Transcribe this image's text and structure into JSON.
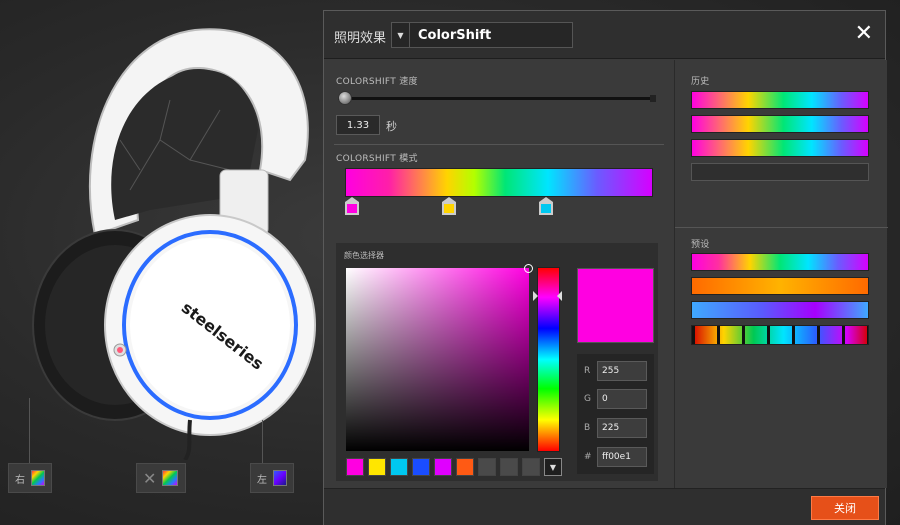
{
  "dialog": {
    "title": "照明效果",
    "effect_value": "ColorShift",
    "close_button": "关闭"
  },
  "speed": {
    "label": "COLORSHIFT 速度",
    "value": "1.33",
    "unit": "秒",
    "slider_fraction": 0.0
  },
  "pattern": {
    "label": "COLORSHIFT 模式",
    "stops": [
      {
        "color": "#ff00e1",
        "position": 0.0
      },
      {
        "color": "#ffd400",
        "position": 0.33
      },
      {
        "color": "#00c8f0",
        "position": 0.66
      }
    ]
  },
  "picker": {
    "label": "颜色选择器",
    "current_color": "#ff00e1",
    "r": "255",
    "g": "0",
    "b": "225",
    "hex": "ff00e1",
    "r_label": "R",
    "g_label": "G",
    "b_label": "B",
    "hex_label": "#",
    "palette": [
      "#ff00e1",
      "#ffe600",
      "#00c8f0",
      "#1a4dff",
      "#e000ff",
      "#ff5a14",
      "#4a4a4a",
      "#4a4a4a",
      "#4a4a4a"
    ],
    "more_icon": "▼"
  },
  "history": {
    "label": "历史",
    "items": [
      "rainbow-magenta-start",
      "rainbow-magenta-start",
      "rainbow-magenta-start",
      "empty"
    ]
  },
  "presets": {
    "label": "预设",
    "items": [
      "rainbow",
      "orange-fire",
      "blue-violet",
      "segmented-rainbow"
    ]
  },
  "zones": [
    {
      "label": "右"
    },
    {
      "label": ""
    },
    {
      "label": "左"
    }
  ]
}
